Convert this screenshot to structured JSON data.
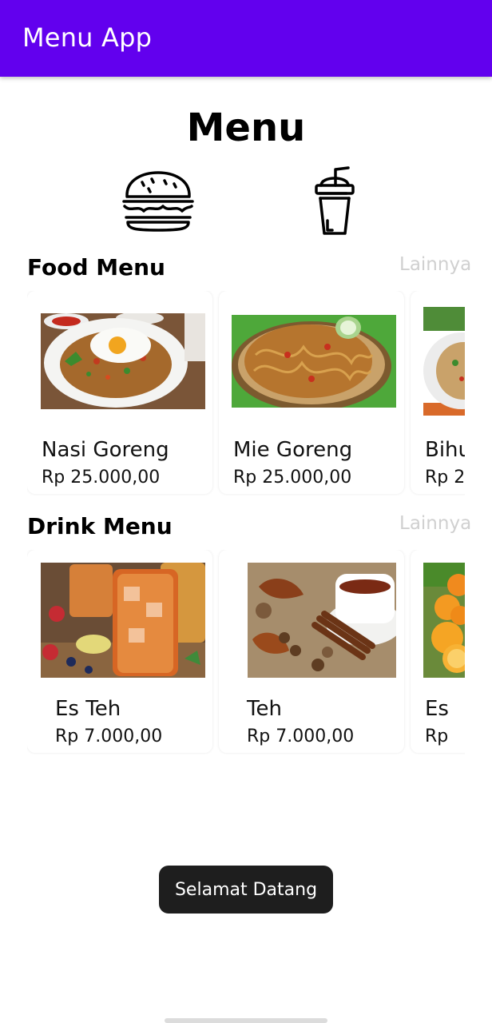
{
  "app_bar": {
    "title": "Menu App",
    "color": "#6200ee"
  },
  "page": {
    "title": "Menu"
  },
  "categories": [
    {
      "icon": "burger-icon"
    },
    {
      "icon": "drink-cup-icon"
    }
  ],
  "food_section": {
    "title": "Food Menu",
    "more_label": "Lainnya",
    "items": [
      {
        "name": "Nasi Goreng",
        "price": "Rp 25.000,00",
        "image": "nasi-goreng-image"
      },
      {
        "name": "Mie Goreng",
        "price": "Rp 25.000,00",
        "image": "mie-goreng-image"
      },
      {
        "name": "Bihu",
        "price": "Rp 2",
        "image": "bihun-image"
      }
    ]
  },
  "drink_section": {
    "title": "Drink Menu",
    "more_label": "Lainnya",
    "items": [
      {
        "name": "Es Teh",
        "price": "Rp 7.000,00",
        "image": "iced-tea-image"
      },
      {
        "name": "Teh",
        "price": "Rp 7.000,00",
        "image": "hot-tea-image"
      },
      {
        "name": "Es",
        "price": "Rp",
        "image": "orange-juice-image"
      }
    ]
  },
  "toast": {
    "message": "Selamat Datang"
  }
}
